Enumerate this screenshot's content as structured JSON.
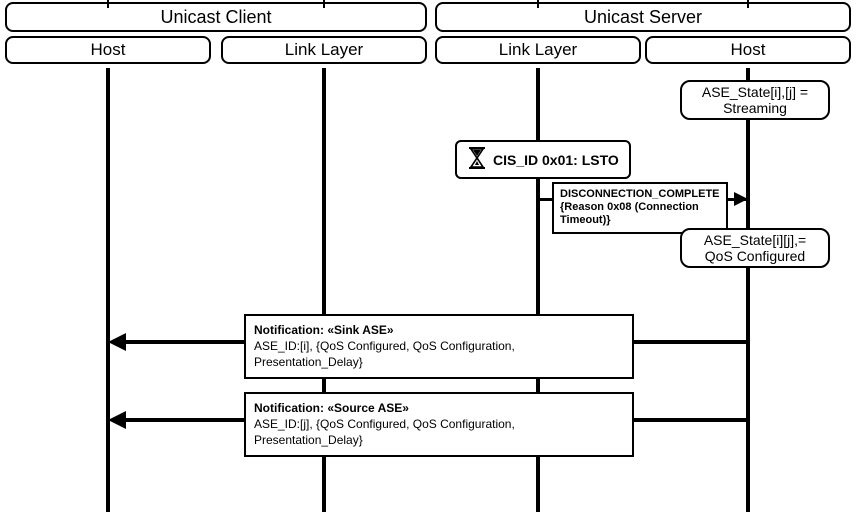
{
  "participants": {
    "unicast_client": {
      "label": "Unicast Client"
    },
    "unicast_server": {
      "label": "Unicast Server"
    },
    "client_host": {
      "label": "Host"
    },
    "client_ll": {
      "label": "Link Layer"
    },
    "server_ll": {
      "label": "Link Layer"
    },
    "server_host": {
      "label": "Host"
    }
  },
  "states": {
    "initial": "ASE_State[i],[j] = Streaming",
    "after": "ASE_State[i][j],= QoS Configured"
  },
  "lsto": {
    "text": "CIS_ID 0x01: LSTO",
    "icon": "hourglass-icon"
  },
  "disconnect": {
    "line1": "DISCONNECTION_COMPLETE",
    "line2": "{Reason 0x08 (Connection Timeout)}"
  },
  "notifications": {
    "sink": {
      "title": "Notification: «Sink ASE»",
      "body": "ASE_ID:[i], {QoS Configured, QoS Configuration, Presentation_Delay}"
    },
    "source": {
      "title": "Notification: «Source ASE»",
      "body": "ASE_ID:[j], {QoS Configured, QoS Configuration, Presentation_Delay}"
    }
  },
  "chart_data": {
    "type": "sequence-diagram",
    "participants": [
      {
        "id": "client_host",
        "group": "Unicast Client",
        "label": "Host"
      },
      {
        "id": "client_ll",
        "group": "Unicast Client",
        "label": "Link Layer"
      },
      {
        "id": "server_ll",
        "group": "Unicast Server",
        "label": "Link Layer"
      },
      {
        "id": "server_host",
        "group": "Unicast Server",
        "label": "Host"
      }
    ],
    "events": [
      {
        "step": 1,
        "at": "server_host",
        "kind": "state",
        "text": "ASE_State[i],[j] = Streaming"
      },
      {
        "step": 2,
        "at": "server_ll",
        "kind": "timer",
        "text": "CIS_ID 0x01: LSTO"
      },
      {
        "step": 3,
        "from": "server_ll",
        "to": "server_host",
        "kind": "message",
        "text": "DISCONNECTION_COMPLETE {Reason 0x08 (Connection Timeout)}"
      },
      {
        "step": 4,
        "at": "server_host",
        "kind": "state",
        "text": "ASE_State[i][j],= QoS Configured"
      },
      {
        "step": 5,
        "from": "server_host",
        "to": "client_host",
        "kind": "notification",
        "title": "Notification: «Sink ASE»",
        "text": "ASE_ID:[i], {QoS Configured, QoS Configuration, Presentation_Delay}"
      },
      {
        "step": 6,
        "from": "server_host",
        "to": "client_host",
        "kind": "notification",
        "title": "Notification: «Source ASE»",
        "text": "ASE_ID:[j], {QoS Configured, QoS Configuration, Presentation_Delay}"
      }
    ]
  }
}
